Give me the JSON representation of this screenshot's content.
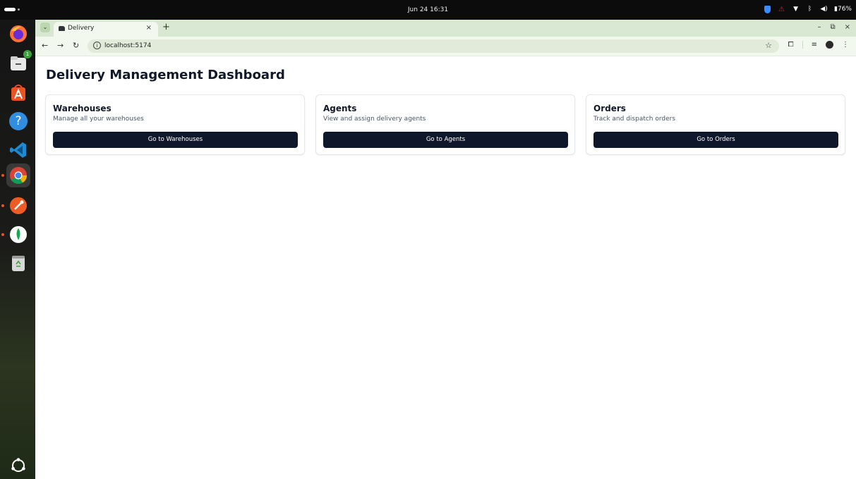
{
  "system": {
    "clock": "Jun 24  16:31",
    "battery": "76%"
  },
  "dock": {
    "items": [
      "firefox",
      "files",
      "app-center",
      "help",
      "vscode",
      "chrome",
      "postman",
      "mongodb-compass",
      "trash"
    ],
    "files_badge": "1"
  },
  "browser": {
    "tab_title": "Delivery",
    "url": "localhost:5174"
  },
  "page": {
    "title": "Delivery Management Dashboard",
    "cards": [
      {
        "title": "Warehouses",
        "description": "Manage all your warehouses",
        "button": "Go to Warehouses"
      },
      {
        "title": "Agents",
        "description": "View and assign delivery agents",
        "button": "Go to Agents"
      },
      {
        "title": "Orders",
        "description": "Track and dispatch orders",
        "button": "Go to Orders"
      }
    ]
  },
  "colors": {
    "button_bg": "#0f172a",
    "tabstrip": "#d9e8d2",
    "ubuntu_accent": "#e95420"
  }
}
